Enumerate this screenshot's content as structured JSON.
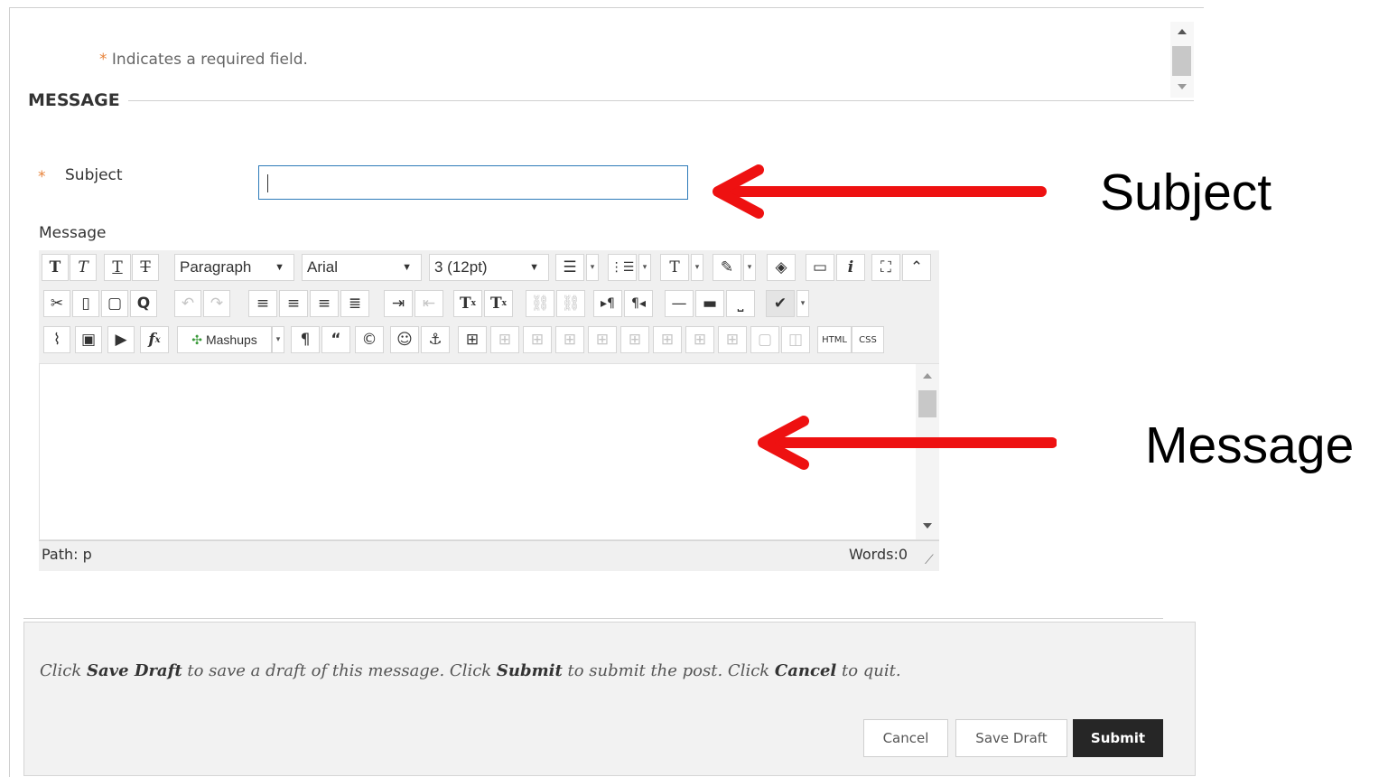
{
  "form": {
    "required_note_star": "*",
    "required_note": "Indicates a required field.",
    "section_title": "MESSAGE",
    "subject": {
      "star": "*",
      "label": "Subject",
      "value": ""
    },
    "message_label": "Message"
  },
  "toolbar": {
    "row1": {
      "format_select": "Paragraph",
      "font_select": "Arial",
      "size_select": "3 (12pt)"
    },
    "row3": {
      "mashups_label": "Mashups",
      "html_label": "HTML",
      "css_label": "CSS"
    }
  },
  "editor": {
    "path_label": "Path: p",
    "words_label": "Words:0"
  },
  "footer": {
    "text": {
      "p1": "Click ",
      "save_draft": "Save Draft",
      "p2": " to save a draft of this message. Click ",
      "submit": "Submit",
      "p3": " to submit the post. Click ",
      "cancel": "Cancel",
      "p4": " to quit."
    },
    "buttons": {
      "cancel": "Cancel",
      "save_draft": "Save Draft",
      "submit": "Submit"
    }
  },
  "annotations": {
    "subject": "Subject",
    "message": "Message",
    "arrow_color": "#ee1111"
  },
  "colors": {
    "required_star": "#e8833a",
    "input_focus_border": "#2e7bb9",
    "submit_bg": "#262626"
  }
}
